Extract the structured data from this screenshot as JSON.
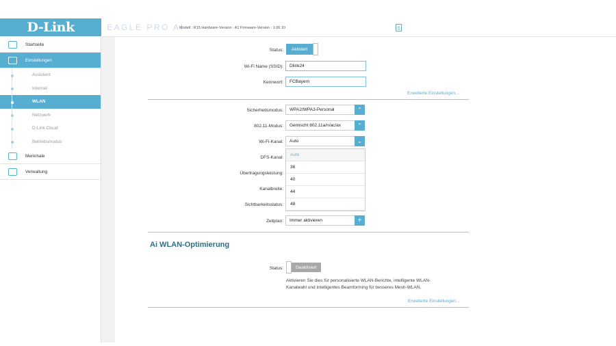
{
  "header": {
    "logo": "D-Link",
    "brand": "EAGLE PRO AI",
    "model_info": "Modell : R15  Hardware-Version : A1  Firmware-Version : 1.06.10"
  },
  "sidebar": {
    "items": [
      {
        "label": "Startseite",
        "icon": "home-network-icon"
      },
      {
        "label": "Einstellungen",
        "icon": "settings-icon"
      },
      {
        "label": "Merkmale",
        "icon": "features-icon"
      },
      {
        "label": "Verwaltung",
        "icon": "management-icon"
      }
    ],
    "subitems": [
      "Assistent",
      "Internet",
      "WLAN",
      "Netzwerk",
      "D-Link Cloud",
      "Betriebsmodus"
    ]
  },
  "wlan": {
    "status_label": "Status:",
    "status_value": "Aktiviert",
    "ssid_label": "Wi-Fi Name (SSID):",
    "ssid_value": "Dlink24",
    "password_label": "Kennwort:",
    "password_value": "FCBayern",
    "advanced_link": "Erweiterte Einstellungen...",
    "security_label": "Sicherheitsmodus:",
    "security_value": "WPA2/WPA3-Personal",
    "mode_label": "802.11-Modus:",
    "mode_value": "Gemischt 802.11a/n/ac/ax",
    "channel_label": "Wi-Fi-Kanal:",
    "channel_value": "Auto",
    "dfs_label": "DFS-Kanal:",
    "power_label": "Übertragungsleistung:",
    "width_label": "Kanalbreite:",
    "visibility_label": "Sichtbarkeitsstatus:",
    "schedule_label": "Zeitplan:",
    "schedule_value": "Immer aktivieren",
    "channel_options": [
      "Auto",
      "36",
      "40",
      "44",
      "48"
    ]
  },
  "ai": {
    "title": "Ai WLAN-Optimierung",
    "status_label": "Status:",
    "status_value": "Deaktiviert",
    "desc_line1": "Aktivieren Sie dies für personalisierte WLAN-Berichte, intelligente WLAN-",
    "desc_line2": "Kanalwahl und intelligentes Beamforming für besseres Mesh-WLAN.",
    "advanced_link": "Erweiterte Einstellungen..."
  },
  "colors": {
    "accent": "#58aed0",
    "title": "#2c6e86"
  }
}
